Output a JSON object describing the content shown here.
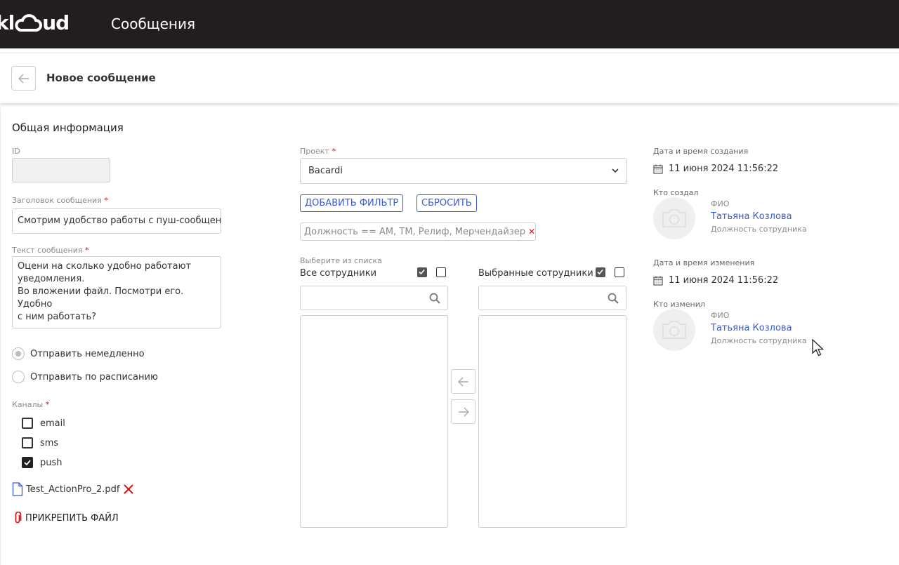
{
  "app": {
    "logo_text": "klOud",
    "logo_tail": "ud",
    "logo_head": "l",
    "title": "Сообщения"
  },
  "page": {
    "title": "Новое сообщение"
  },
  "form": {
    "section_title": "Общая информация",
    "id_label": "ID",
    "id_value": "",
    "subject_label": "Заголовок сообщения",
    "subject_value": "Смотрим удобство работы с пуш-сообщениями",
    "text_label": "Текст сообщения",
    "text_value": "Оцени на сколько удобно работают\nуведомления.\nВо вложении файл. Посмотри его. Удобно\nс ним работать?",
    "send_options": [
      {
        "label": "Отправить немедленно",
        "selected": true
      },
      {
        "label": "Отправить по расписанию",
        "selected": false
      }
    ],
    "channels_label": "Каналы",
    "channels": [
      {
        "label": "email",
        "checked": false
      },
      {
        "label": "sms",
        "checked": false
      },
      {
        "label": "push",
        "checked": true
      }
    ],
    "file_name": "Test_ActionPro_2.pdf",
    "attach_label": "ПРИКРЕПИТЬ ФАЙЛ",
    "required_mark": "*"
  },
  "recipients": {
    "project_label": "Проект",
    "project_value": "Bacardi",
    "add_filter_label": "ДОБАВИТЬ ФИЛЬТР",
    "reset_label": "СБРОСИТЬ",
    "filter_chip": "Должность == АМ, ТМ, Релиф, Мерчендайзер",
    "select_from_list_label": "Выберите из списка",
    "all_employees_label": "Все сотрудники",
    "selected_employees_label": "Выбранные сотрудники",
    "all_search_placeholder": "",
    "selected_search_placeholder": ""
  },
  "meta": {
    "created_label": "Дата и время создания",
    "created_value": "11 июня 2024 11:56:22",
    "created_by_label": "Кто создал",
    "creator": {
      "fio_label": "ФИО",
      "name": "Татьяна Козлова",
      "position": "Должность сотрудника"
    },
    "modified_label": "Дата и время изменения",
    "modified_value": "11 июня 2024 11:56:22",
    "modified_by_label": "Кто изменил",
    "modifier": {
      "fio_label": "ФИО",
      "name": "Татьяна Козлова",
      "position": "Должность сотрудника"
    }
  },
  "colors": {
    "topbar": "#221e1f",
    "accent": "#3b5bd6",
    "danger": "#d11111"
  }
}
